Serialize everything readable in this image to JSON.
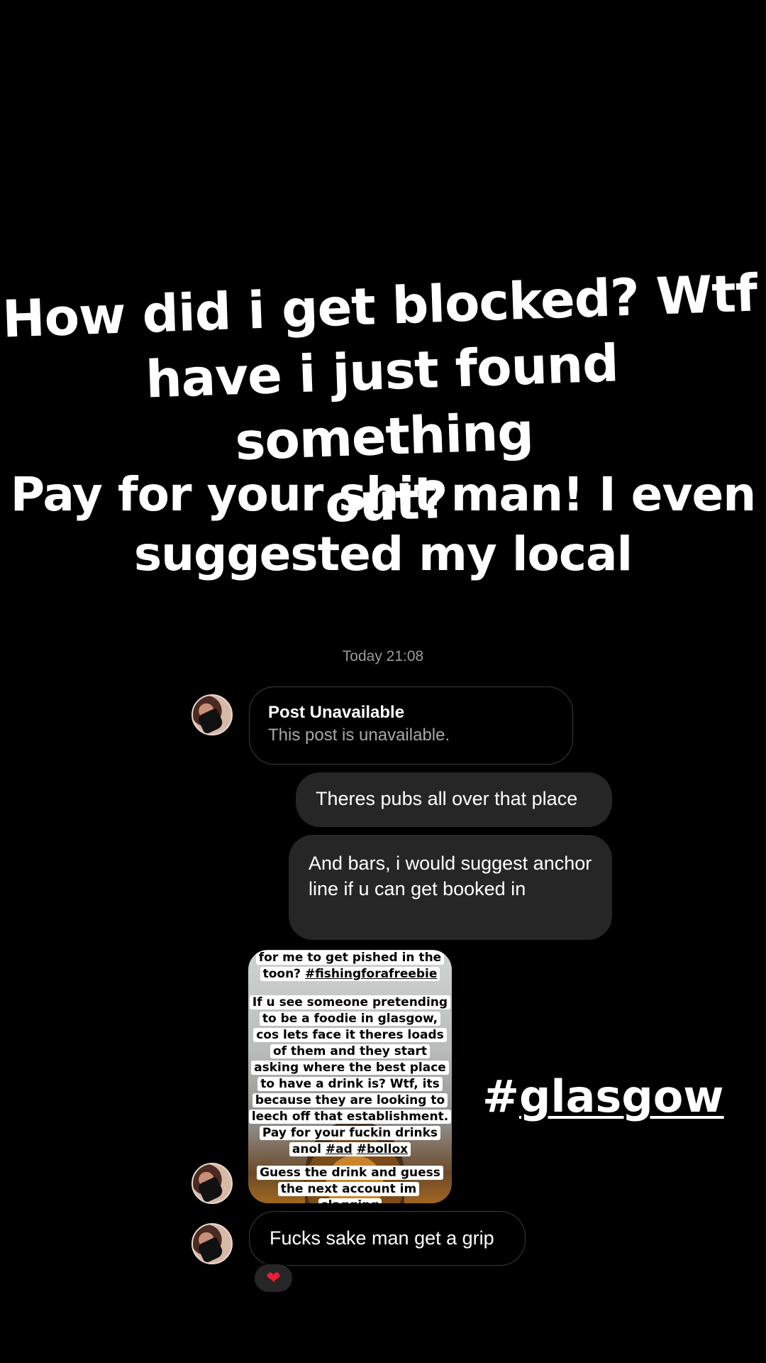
{
  "story_caption_1": "How did i get blocked? Wtf\nhave i just found something\nout?",
  "story_caption_2": "Pay for your shit man! I even\nsuggested my local",
  "timestamp": "Today 21:08",
  "messages": {
    "post_unavailable": {
      "title": "Post Unavailable",
      "subtitle": "This post is unavailable."
    },
    "pubs": "Theres pubs all over that place",
    "bars": "And bars, i would suggest anchor line if u can get booked in",
    "grip": "Fucks sake man get a grip"
  },
  "story_share": {
    "top_line_1": "for me to get pished in the",
    "top_line_2a": "toon? ",
    "top_line_2_tag": "#fishingforafreebie",
    "mid_lines": [
      "If u see someone pretending",
      "to be a foodie in glasgow,",
      "cos lets face it theres loads",
      "of them and they start",
      "asking where the best place",
      "to have a drink is? Wtf, its",
      "because they are looking to",
      "leech off that establishment.",
      "Pay for your fuckin drinks"
    ],
    "mid_last_a": "anol ",
    "mid_last_tag1": "#ad",
    "mid_last_space": " ",
    "mid_last_tag2": "#bollox",
    "bottom_line_1": "Guess the drink and guess",
    "bottom_line_2": "the next account im slagging"
  },
  "hashtag_sticker": {
    "hash": "#",
    "text": "glasgow"
  },
  "reaction": {
    "emoji": "❤",
    "icon": "heart-icon",
    "color": "#ee1d36"
  },
  "colors": {
    "background": "#000000",
    "bubble_fill": "#262626",
    "bubble_border": "#3a3a3a",
    "secondary_text": "#a8a8a8"
  }
}
